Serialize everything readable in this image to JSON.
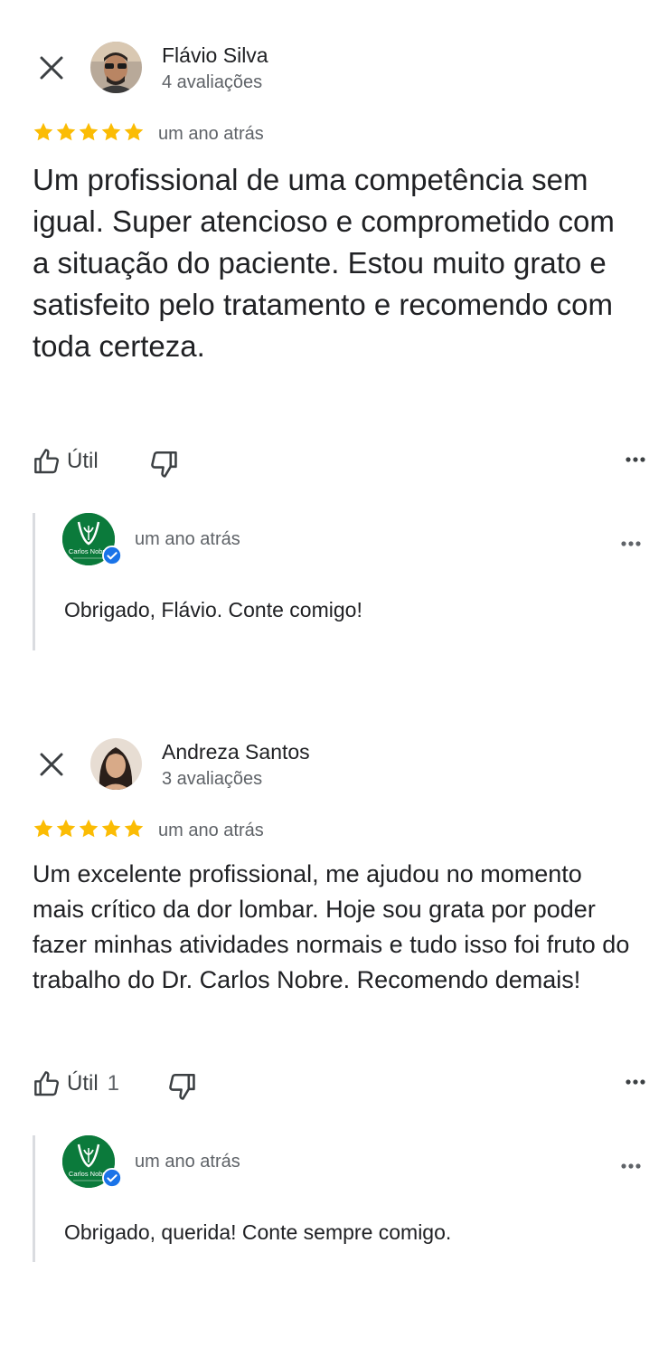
{
  "colors": {
    "star": "#fbbc04",
    "text_primary": "#202124",
    "text_secondary": "#5f6368",
    "owner_green": "#0b7a3b",
    "verified_blue": "#1a73e8"
  },
  "reviews": [
    {
      "author": "Flávio Silva",
      "review_count": "4 avaliações",
      "rating": 5,
      "date": "um ano atrás",
      "text": "Um profissional de uma competência sem igual. Super atencioso e comprometido com a situação do paciente. Estou muito grato e satisfeito pelo tratamento e recomendo com toda certeza.",
      "useful_label": "Útil",
      "useful_count": "",
      "reply": {
        "owner_logo_text": "Carlos Nobre",
        "date": "um ano atrás",
        "text": "Obrigado, Flávio. Conte comigo!"
      }
    },
    {
      "author": "Andreza Santos",
      "review_count": "3 avaliações",
      "rating": 5,
      "date": "um ano atrás",
      "text": "Um excelente profissional, me ajudou no momento mais crítico da dor lombar. Hoje sou grata por poder fazer minhas atividades normais e tudo isso foi fruto do trabalho do Dr. Carlos Nobre. Recomendo demais!",
      "useful_label": "Útil",
      "useful_count": "1",
      "reply": {
        "owner_logo_text": "Carlos Nobre",
        "date": "um ano atrás",
        "text": "Obrigado, querida! Conte sempre comigo."
      }
    }
  ]
}
